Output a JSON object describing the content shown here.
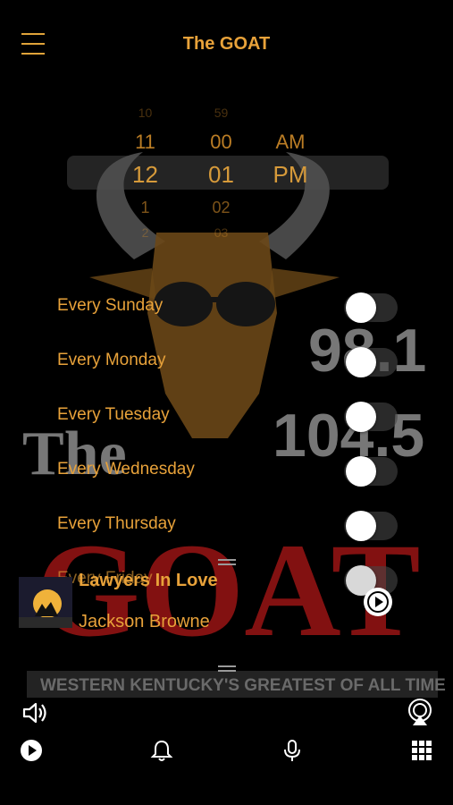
{
  "header": {
    "title": "The GOAT"
  },
  "station_logo": {
    "frequencies": [
      "98.1",
      "104.5"
    ],
    "word_the": "The",
    "word_goat": "GOAT",
    "tagline": "WESTERN KENTUCKY'S GREATEST OF ALL TIME"
  },
  "time_picker": {
    "hours": [
      "10",
      "11",
      "12",
      "1",
      "2"
    ],
    "minutes": [
      "59",
      "00",
      "01",
      "02",
      "03"
    ],
    "periods": [
      "AM",
      "PM"
    ]
  },
  "days": [
    {
      "label": "Every Sunday",
      "on": false
    },
    {
      "label": "Every Monday",
      "on": false
    },
    {
      "label": "Every Tuesday",
      "on": false
    },
    {
      "label": "Every Wednesday",
      "on": false
    },
    {
      "label": "Every Thursday",
      "on": false
    },
    {
      "label": "Every Friday",
      "on": false
    }
  ],
  "now_playing": {
    "title": "Lawyers In Love",
    "artist": "Jackson Browne"
  },
  "bottom_nav": [
    "play-icon",
    "bell-icon",
    "microphone-icon",
    "grid-icon"
  ],
  "colors": {
    "accent": "#e8a23a",
    "background": "#000000",
    "goat_red": "#8a1212"
  }
}
